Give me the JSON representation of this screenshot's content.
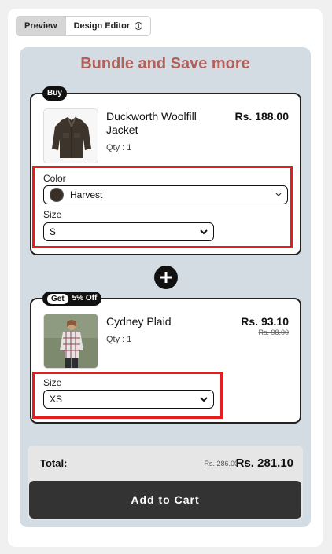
{
  "tabs": {
    "preview_label": "Preview",
    "design_editor_label": "Design Editor"
  },
  "bundle": {
    "title": "Bundle and Save more"
  },
  "product1": {
    "badge": "Buy",
    "name": "Duckworth Woolfill Jacket",
    "qty": "Qty : 1",
    "price": "Rs. 188.00",
    "color_label": "Color",
    "color_value": "Harvest",
    "size_label": "Size",
    "size_value": "S"
  },
  "product2": {
    "badge_prefix": "Get",
    "badge_discount": "5% Off",
    "name": "Cydney Plaid",
    "qty": "Qty : 1",
    "price": "Rs. 93.10",
    "old_price": "Rs. 98.00",
    "size_label": "Size",
    "size_value": "XS"
  },
  "totals": {
    "label": "Total:",
    "old_total": "Rs. 286.00",
    "new_total": "Rs. 281.10",
    "cta": "Add to Cart"
  },
  "colors": {
    "title": "#b2605b",
    "highlight": "#e41e1e",
    "canvas_bg": "#d3dce2",
    "cta_bg": "#333333"
  },
  "icons": {
    "info": "info-icon",
    "plus": "plus-icon",
    "chevron": "chevron-down-icon"
  }
}
